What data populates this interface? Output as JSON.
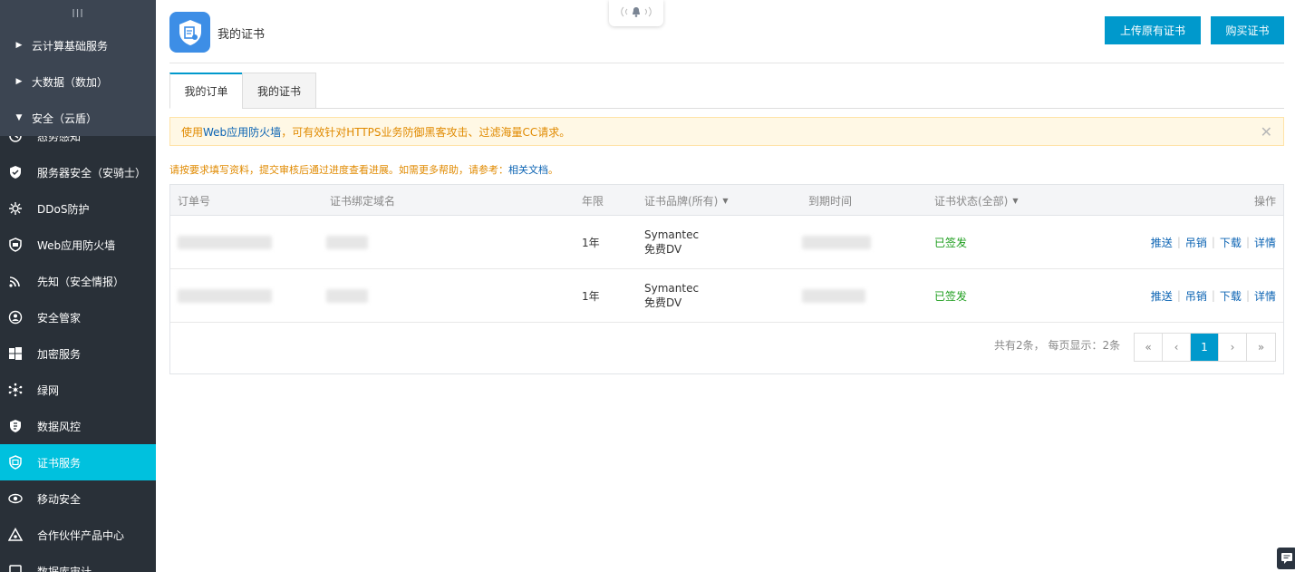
{
  "sidebar": {
    "collapse_label": "III",
    "groups": [
      {
        "label": "云计算基础服务",
        "expanded": false
      },
      {
        "label": "大数据（数加）",
        "expanded": false
      },
      {
        "label": "安全（云盾）",
        "expanded": true
      }
    ],
    "items": [
      {
        "label": "态势感知",
        "icon": "situation-icon"
      },
      {
        "label": "服务器安全（安骑士）",
        "icon": "shield-icon"
      },
      {
        "label": "DDoS防护",
        "icon": "gear-icon"
      },
      {
        "label": "Web应用防火墙",
        "icon": "firewall-icon"
      },
      {
        "label": "先知（安全情报）",
        "icon": "radar-icon"
      },
      {
        "label": "安全管家",
        "icon": "steward-icon"
      },
      {
        "label": "加密服务",
        "icon": "windows-icon"
      },
      {
        "label": "绿网",
        "icon": "network-icon"
      },
      {
        "label": "数据风控",
        "icon": "risk-icon"
      },
      {
        "label": "证书服务",
        "icon": "certificate-icon",
        "active": true
      },
      {
        "label": "移动安全",
        "icon": "mobile-security-icon"
      },
      {
        "label": "合作伙伴产品中心",
        "icon": "partner-icon"
      },
      {
        "label": "数据库审计",
        "icon": "audit-icon"
      }
    ]
  },
  "header": {
    "title": "我的证书",
    "upload_button": "上传原有证书",
    "buy_button": "购买证书"
  },
  "tabs": [
    {
      "label": "我的订单",
      "active": true
    },
    {
      "label": "我的证书",
      "active": false
    }
  ],
  "notice": {
    "prefix": "使用",
    "link": "Web应用防火墙",
    "suffix": "，可有效针对HTTPS业务防御黑客攻击、过滤海量CC请求。",
    "close": "✕"
  },
  "hint": {
    "text": "请按要求填写资料，提交审核后通过进度查看进展。如需更多帮助，请参考：",
    "link": "相关文档",
    "end": "。"
  },
  "table": {
    "columns": [
      "订单号",
      "证书绑定域名",
      "年限",
      "证书品牌(所有)",
      "到期时间",
      "证书状态(全部)",
      "操作"
    ],
    "rows": [
      {
        "years": "1年",
        "brand": "Symantec",
        "type": "免费DV",
        "status": "已签发",
        "actions": [
          "推送",
          "吊销",
          "下载",
          "详情"
        ]
      },
      {
        "years": "1年",
        "brand": "Symantec",
        "type": "免费DV",
        "status": "已签发",
        "actions": [
          "推送",
          "吊销",
          "下载",
          "详情"
        ]
      }
    ]
  },
  "pagination": {
    "info": "共有2条， 每页显示：2条",
    "first": "«",
    "prev": "‹",
    "current": "1",
    "next": "›",
    "last": "»"
  },
  "colors": {
    "sidebar_bg": "#293038",
    "sidebar_active": "#00c1de",
    "primary_button": "#0099cc",
    "status_issued": "#1e9e1e",
    "notice_text": "#e08a00"
  }
}
